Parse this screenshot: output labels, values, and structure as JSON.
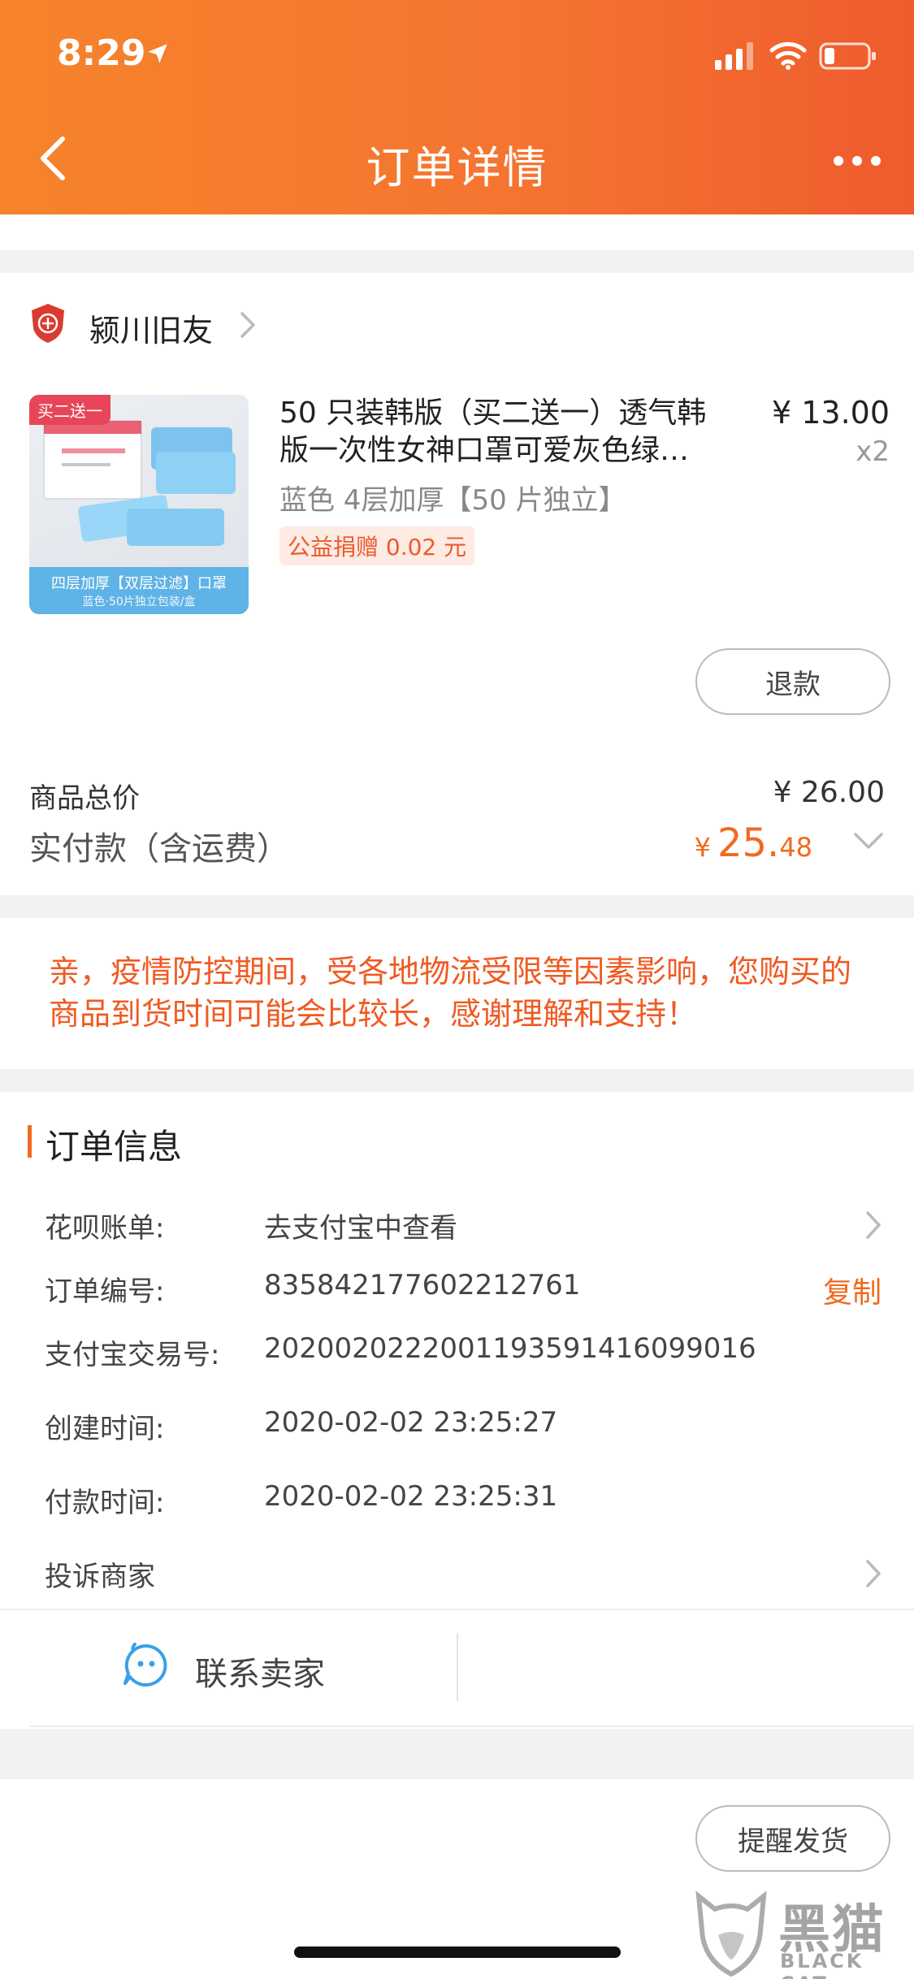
{
  "status_bar": {
    "time": "8:29"
  },
  "nav": {
    "title": "订单详情"
  },
  "shop": {
    "name": "颍川旧友"
  },
  "product": {
    "image_tag": "买二送一",
    "image_band_line1": "四层加厚【双层过滤】口罩",
    "image_band_line2": "蓝色·50片独立包装/盒",
    "title": "50 只装韩版（买二送一）透气韩版一次性女神口罩可爱灰色绿…",
    "price": "¥ 13.00",
    "quantity": "x2",
    "sku": "蓝色 4层加厚【50 片独立】",
    "charity": "公益捐赠 0.02 元",
    "refund_label": "退款"
  },
  "summary": {
    "total_label": "商品总价",
    "total_value": "¥ 26.00",
    "paid_label": "实付款（含运费）",
    "paid_symbol": "¥",
    "paid_int": "25.",
    "paid_dec": "48"
  },
  "notice": "亲，疫情防控期间，受各地物流受限等因素影响，您购买的商品到货时间可能会比较长，感谢理解和支持！",
  "order_info": {
    "title": "订单信息",
    "huabei_label": "花呗账单:",
    "huabei_value": "去支付宝中查看",
    "order_no_label": "订单编号:",
    "order_no_value": "835842177602212761",
    "copy_label": "复制",
    "alipay_label": "支付宝交易号:",
    "alipay_value": "2020020222001193591416099016",
    "created_label": "创建时间:",
    "created_value": "2020-02-02 23:25:27",
    "paid_time_label": "付款时间:",
    "paid_time_value": "2020-02-02 23:25:31",
    "complaint_label": "投诉商家"
  },
  "contact": {
    "label": "联系卖家"
  },
  "footer": {
    "remind_label": "提醒发货"
  },
  "watermark": {
    "cn": "黑猫",
    "en": "BLACK CAT"
  },
  "colors": {
    "accent": "#f06a1f",
    "header_start": "#f6832b",
    "header_end": "#ef5b2d",
    "notice": "#f05a22"
  },
  "icons": [
    "location-arrow-icon",
    "signal-icon",
    "wifi-icon",
    "battery-icon",
    "back-chevron-icon",
    "more-dots-icon",
    "shop-shield-icon",
    "chevron-right-icon",
    "chevron-down-icon",
    "chat-face-icon"
  ]
}
